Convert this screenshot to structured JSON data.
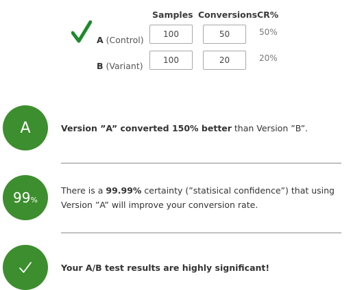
{
  "table": {
    "headers": {
      "samples": "Samples",
      "conversions": "Conversions",
      "cr": "CR%"
    },
    "rows": [
      {
        "letter": "A",
        "name": "(Control)",
        "samples": "100",
        "conversions": "50",
        "cr": "50%"
      },
      {
        "letter": "B",
        "name": "(Variant)",
        "samples": "100",
        "conversions": "20",
        "cr": "20%"
      }
    ],
    "winner_icon": "green-checkmark-icon"
  },
  "results": [
    {
      "badge": "A",
      "parts": [
        "Version ”A” converted 150% better",
        " than Version ”B”."
      ]
    },
    {
      "badge_num": "99",
      "badge_unit": "%",
      "parts": [
        "There is a ",
        "99.99%",
        " certainty (”statisical confidence”) that using Version ”A” will improve your conversion rate."
      ]
    },
    {
      "badge_icon": "checkmark-icon",
      "parts": [
        "Your A/B test results are ",
        "highly significant!"
      ]
    }
  ],
  "colors": {
    "accent_green": "#3d8e2e",
    "check_green": "#1e8a2c"
  }
}
